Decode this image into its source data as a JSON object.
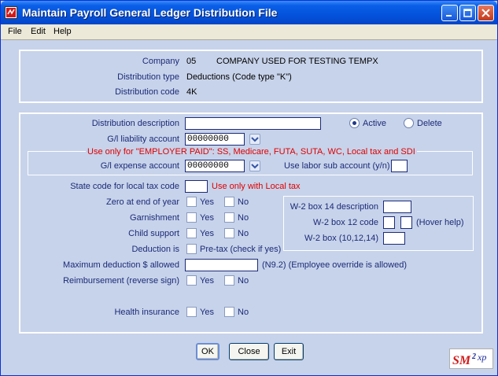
{
  "window": {
    "title": "Maintain Payroll General Ledger Distribution File"
  },
  "menu": {
    "file": "File",
    "edit": "Edit",
    "help": "Help"
  },
  "header": {
    "company_label": "Company",
    "company_code": "05",
    "company_name": "COMPANY USED FOR TESTING TEMPX",
    "dist_type_label": "Distribution type",
    "dist_type_value": "Deductions (Code type \"K\")",
    "dist_code_label": "Distribution code",
    "dist_code_value": "4K"
  },
  "form": {
    "description_label": "Distribution description",
    "description_value": "",
    "status_active": "Active",
    "status_delete": "Delete",
    "status_selected": "Active",
    "liability_label": "G/l liability account",
    "liability_value": "00000000",
    "employer_paid_note": "Use only for \"EMPLOYER PAID\":  SS, Medicare, FUTA, SUTA, WC, Local tax and SDI",
    "expense_label": "G/l expense account",
    "expense_value": "00000000",
    "labor_sub_label": "Use labor sub account (y/n)",
    "labor_sub_value": "",
    "state_code_label": "State code for local tax code",
    "state_code_value": "",
    "state_code_note": "Use only with Local tax",
    "zero_label": "Zero at end of year",
    "garnishment_label": "Garnishment",
    "child_support_label": "Child support",
    "deduction_is_label": "Deduction is",
    "pretax_label": "Pre-tax (check if yes)",
    "max_deduction_label": "Maximum deduction $ allowed",
    "max_deduction_value": "",
    "max_deduction_note": "(N9.2) (Employee override is allowed)",
    "reimbursement_label": "Reimbursement (reverse sign)",
    "health_label": "Health insurance",
    "yes": "Yes",
    "no": "No"
  },
  "w2": {
    "box14_label": "W-2 box 14 description",
    "box12_label": "W-2 box 12 code",
    "hover_help": "(Hover help)",
    "box_label": "W-2 box (10,12,14)"
  },
  "buttons": {
    "ok": "OK",
    "close": "Close",
    "exit": "Exit"
  },
  "logo": {
    "text": "SM2xp"
  },
  "colors": {
    "title_bar": "#0453dc",
    "background": "#c7d3ea",
    "label_text": "#1c2a78",
    "warning_text": "#e00000"
  }
}
